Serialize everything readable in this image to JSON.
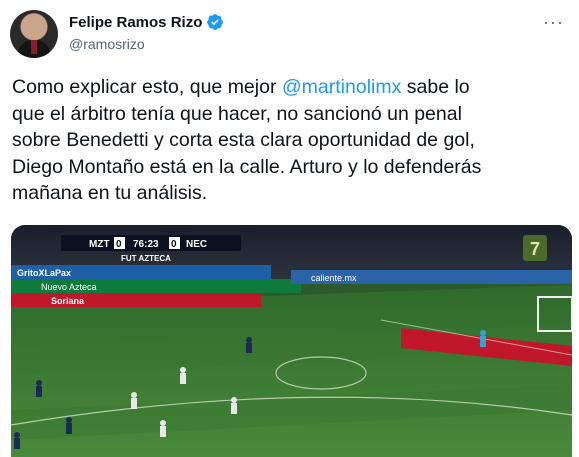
{
  "author": {
    "name": "Felipe Ramos Rizo",
    "handle": "@ramosrizo"
  },
  "tweet": {
    "text_before": "Como explicar esto, que mejor ",
    "mention": "@martinolimx",
    "text_after": " sabe lo\nque el árbitro tenía que hacer, no sancionó un penal\nsobre Benedetti y corta esta clara oportunidad de gol,\nDiego Montaño está en la calle. Arturo y lo defenderás\nmañana en tu análisis."
  },
  "video": {
    "scoreboard": {
      "home": "MZT",
      "home_score": "0",
      "time": "76:23",
      "away_score": "0",
      "away": "NEC",
      "channel": "FUT AZTECA"
    },
    "ads": {
      "gritos": "GritoXLaPax",
      "azteca": "Nuevo Azteca",
      "caliente": "caliente.mx",
      "sorianos": "Soriana",
      "jersey_number": "7"
    }
  },
  "colors": {
    "mention": "#1d9bf0",
    "verified": "#1d9bf0",
    "pitch": "#3f7a33",
    "handle": "#536471"
  }
}
